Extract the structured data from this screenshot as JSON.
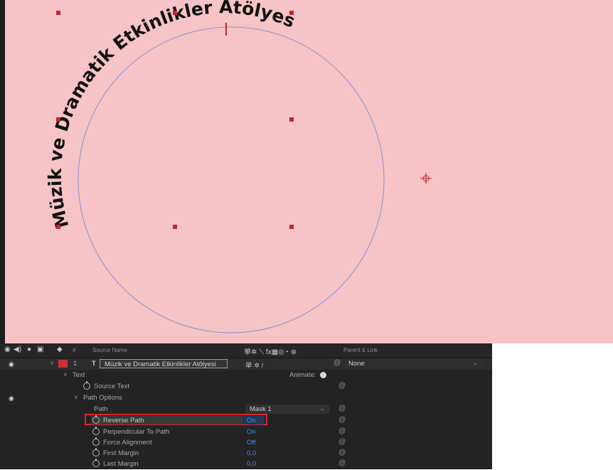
{
  "composition": {
    "text_on_path": "Müzik ve Dramatik Etkinlikler Atölyesi",
    "background_color": "#f6c3c6",
    "mask_color": "#8a95d8",
    "handle_color": "#c0282e"
  },
  "timeline": {
    "header": {
      "icons": [
        "eye-icon",
        "audio-icon",
        "solo-icon",
        "lock-icon",
        "label-icon"
      ],
      "hash": "#",
      "source_name": "Source Name",
      "switches_glyphs": "单✲ ⟍ fx▦◎◔ ⊛",
      "parent_link": "Parent & Link"
    },
    "layer": {
      "number": "1",
      "type_glyph": "T",
      "name": "Müzik ve Dramatik Etkinlikler Atölyesi",
      "switches": "单 ✲ /",
      "parent_value": "None"
    },
    "text_group": {
      "label": "Text",
      "animate_label": "Animate:",
      "source_text": "Source Text"
    },
    "path_options": {
      "label": "Path Options",
      "path_label": "Path",
      "path_value": "Mask 1",
      "properties": [
        {
          "label": "Reverse Path",
          "value": "On"
        },
        {
          "label": "Perpendicular To Path",
          "value": "On"
        },
        {
          "label": "Force Alignment",
          "value": "Off"
        },
        {
          "label": "First Margin",
          "value": "0,0"
        },
        {
          "label": "Last Margin",
          "value": "0,0"
        }
      ]
    },
    "highlight_color": "#e0232b",
    "value_color": "#3d8ee8"
  }
}
